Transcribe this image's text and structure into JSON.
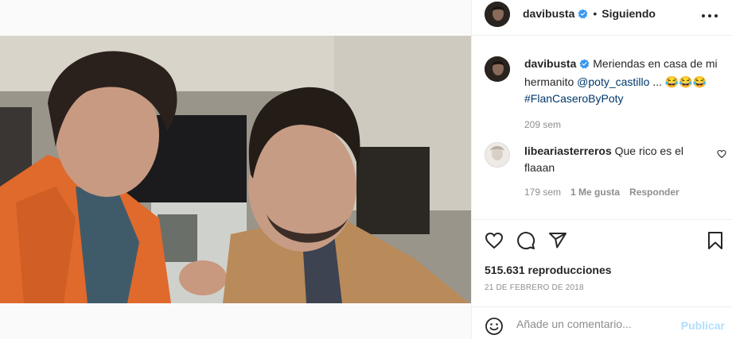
{
  "post": {
    "username": "davibusta",
    "verified": true,
    "follow_status": "Siguiendo",
    "separator": "•"
  },
  "caption": {
    "username": "davibusta",
    "text": "Meriendas en casa de mi hermanito",
    "mention": "@poty_castillo",
    "suffix": "... 😂😂😂",
    "hashtag": "#FlanCaseroByPoty",
    "time": "209 sem"
  },
  "comments": [
    {
      "username": "libeariasterreros",
      "text": "Que rico es el flaaan",
      "time": "179 sem",
      "likes": "1 Me gusta",
      "reply_label": "Responder"
    }
  ],
  "stats": {
    "views": "515.631 reproducciones",
    "date": "21 de febrero de 2018"
  },
  "composer": {
    "placeholder": "Añade un comentario...",
    "publish_label": "Publicar"
  },
  "icons": {
    "more": "more-horizontal-icon",
    "verified": "verified-badge-icon",
    "like": "heart-icon",
    "comment": "comment-icon",
    "share": "share-icon",
    "save": "bookmark-icon",
    "emoji": "emoji-icon",
    "mute": "muted-speaker-icon"
  },
  "colors": {
    "verified": "#3897f0",
    "link": "#00376b",
    "secondary_text": "#8e8e8e",
    "publish_disabled": "#b2dffc",
    "border": "#efefef"
  }
}
